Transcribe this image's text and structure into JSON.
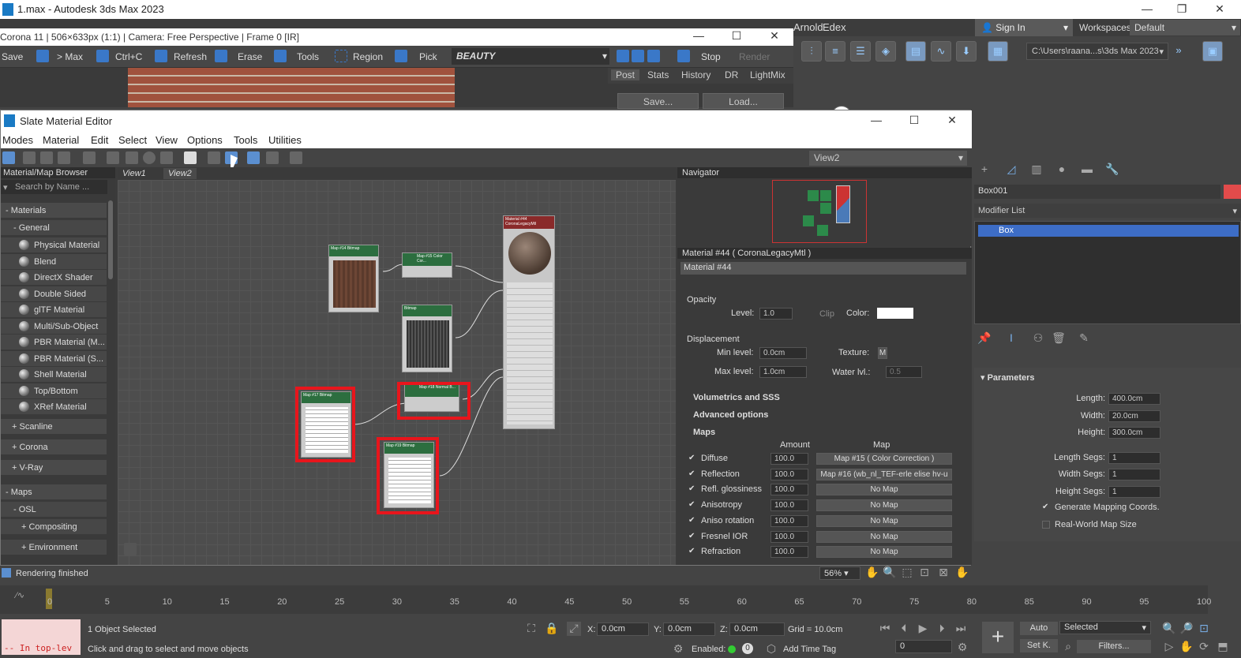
{
  "app": {
    "title": "1.max - Autodesk 3ds Max 2023",
    "menu_visible": [
      "Arnold",
      "Edex"
    ],
    "sign_in": "Sign In",
    "workspaces_label": "Workspaces:",
    "workspace_value": "Default",
    "project_path": "C:\\Users\\raana...s\\3ds Max 2023"
  },
  "corona": {
    "title": "Corona 11 | 506×633px (1:1) | Camera: Free Perspective | Frame 0 [IR]",
    "toolbar": [
      "Save",
      "> Max",
      "Ctrl+C",
      "Refresh",
      "Erase",
      "Tools",
      "Region",
      "Pick"
    ],
    "channel": "BEAUTY",
    "stop": "Stop",
    "render": "Render",
    "tabs": [
      "Post",
      "Stats",
      "History",
      "DR",
      "LightMix"
    ],
    "save_btn": "Save...",
    "load_btn": "Load..."
  },
  "slate": {
    "title": "Slate Material Editor",
    "menu": [
      "Modes",
      "Material",
      "Edit",
      "Select",
      "View",
      "Options",
      "Tools",
      "Utilities"
    ],
    "view_dropdown": "View2",
    "browser_title": "Material/Map Browser",
    "search_placeholder": "Search by Name ...",
    "materials_header": "- Materials",
    "general_header": "- General",
    "general_items": [
      "Physical Material",
      "Blend",
      "DirectX Shader",
      "Double Sided",
      "glTF Material",
      "Multi/Sub-Object",
      "PBR Material (M...",
      "PBR Material (S...",
      "Shell Material",
      "Top/Bottom",
      "XRef Material"
    ],
    "groups": [
      "+ Scanline",
      "+ Corona",
      "+ V-Ray"
    ],
    "maps_header": "- Maps",
    "osl_header": "- OSL",
    "osl_items": [
      "+ Compositing",
      "+ Environment"
    ],
    "view_tabs": [
      "View1",
      "View2"
    ],
    "navigator_title": "Navigator",
    "params_title": "Material #44  ( CoronaLegacyMtl )",
    "mat_name": "Material #44",
    "opacity": {
      "header": "Opacity",
      "level_label": "Level:",
      "level": "1.0",
      "clip": "Clip",
      "color_label": "Color:"
    },
    "displacement": {
      "header": "Displacement",
      "min_label": "Min level:",
      "min": "0.0cm",
      "max_label": "Max level:",
      "max": "1.0cm",
      "texture_label": "Texture:",
      "texture": "M",
      "water_label": "Water lvl.:",
      "water": "0.5"
    },
    "rollouts": [
      "Volumetrics and SSS",
      "Advanced options",
      "Maps"
    ],
    "maps_cols": {
      "amount": "Amount",
      "map": "Map"
    },
    "maps_rows": [
      {
        "name": "Diffuse",
        "amount": "100.0",
        "map": "Map #15  ( Color Correction )"
      },
      {
        "name": "Reflection",
        "amount": "100.0",
        "map": "Map #16 (wb_nl_TEF-erle elise hv-u"
      },
      {
        "name": "Refl. glossiness",
        "amount": "100.0",
        "map": "No Map"
      },
      {
        "name": "Anisotropy",
        "amount": "100.0",
        "map": "No Map"
      },
      {
        "name": "Aniso rotation",
        "amount": "100.0",
        "map": "No Map"
      },
      {
        "name": "Fresnel IOR",
        "amount": "100.0",
        "map": "No Map"
      },
      {
        "name": "Refraction",
        "amount": "100.0",
        "map": "No Map"
      }
    ],
    "nodes": {
      "map14": "Map #14 Bitmap",
      "map15": "Map #15 Color Cor...",
      "bitmap": "Bitmap",
      "map17": "Map #17 Bitmap",
      "map18": "Map #18 Normal B...",
      "map19": "Map #19 Bitmap",
      "material": "Material #44 CoronaLegacyMtl"
    },
    "status": "Rendering finished",
    "zoom": "56%"
  },
  "command_panel": {
    "object_name": "Box001",
    "modifier_list": "Modifier List",
    "stack_item": "Box",
    "params_header": "Parameters",
    "params": [
      {
        "label": "Length:",
        "value": "400.0cm"
      },
      {
        "label": "Width:",
        "value": "20.0cm"
      },
      {
        "label": "Height:",
        "value": "300.0cm"
      },
      {
        "label": "Length Segs:",
        "value": "1"
      },
      {
        "label": "Width Segs:",
        "value": "1"
      },
      {
        "label": "Height Segs:",
        "value": "1"
      }
    ],
    "gen_mapping": "Generate Mapping Coords.",
    "real_world": "Real-World Map Size"
  },
  "timeline": {
    "ticks": [
      "0",
      "5",
      "10",
      "15",
      "20",
      "25",
      "30",
      "35",
      "40",
      "45",
      "50",
      "55",
      "60",
      "65",
      "70",
      "75",
      "80",
      "85",
      "90",
      "95",
      "100"
    ]
  },
  "bottom": {
    "script": "-- In top-lev",
    "selected": "1 Object Selected",
    "hint": "Click and drag to select and move objects",
    "x_label": "X:",
    "x": "0.0cm",
    "y_label": "Y:",
    "y": "0.0cm",
    "z_label": "Z:",
    "z": "0.0cm",
    "grid": "Grid = 10.0cm",
    "enabled": "Enabled:",
    "add_time_tag": "Add Time Tag",
    "auto": "Auto",
    "set_key": "Set K.",
    "selected_dd": "Selected",
    "filters": "Filters...",
    "frame": "0"
  }
}
